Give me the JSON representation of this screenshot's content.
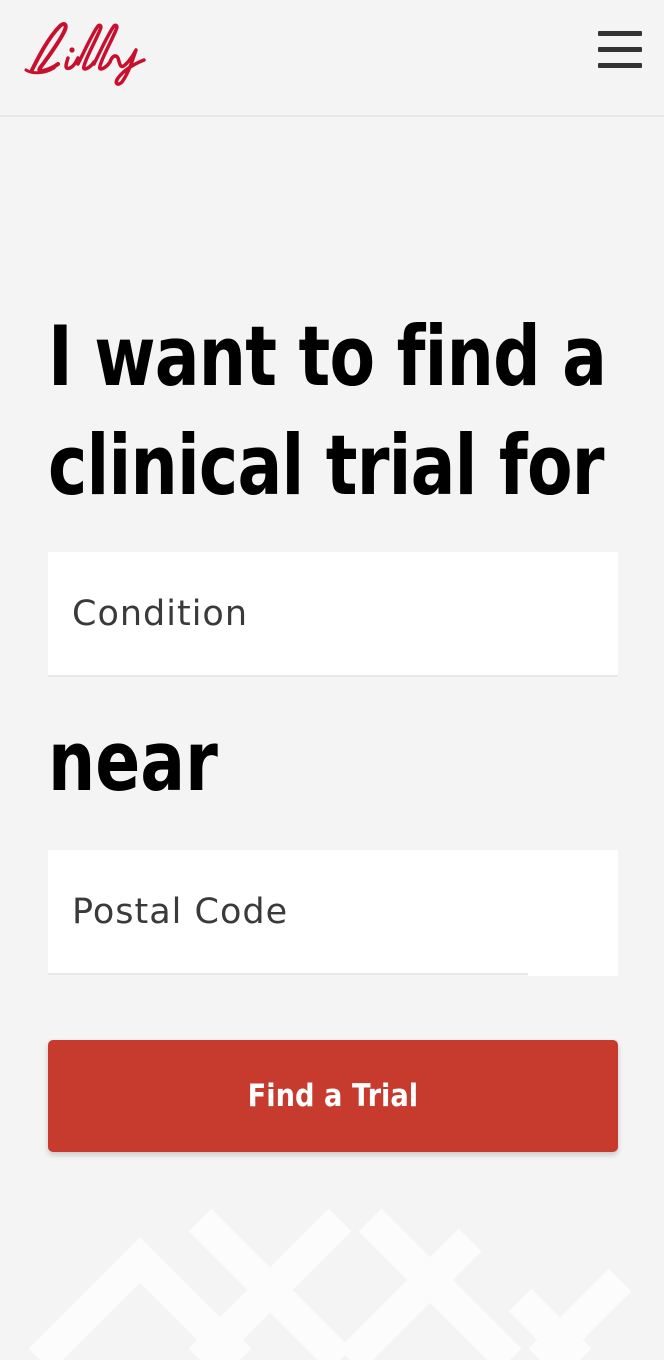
{
  "header": {
    "logo_text": "Lilly",
    "menu_icon": "hamburger-menu-icon",
    "brand_color": "#c8102e"
  },
  "hero": {
    "line1": "I want to find a",
    "line2": "clinical trial for",
    "near_label": "near"
  },
  "form": {
    "condition_placeholder": "Condition",
    "postal_placeholder": "Postal Code",
    "submit_label": "Find a Trial",
    "accent_color": "#c63b2d"
  },
  "background": {
    "pattern_icon": "diamond-lattice-pattern"
  }
}
